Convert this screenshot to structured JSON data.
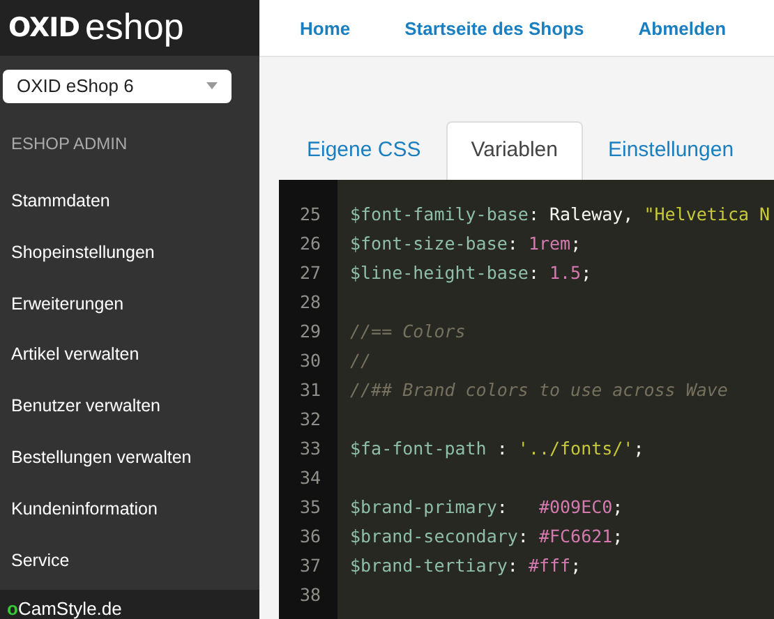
{
  "logo": {
    "bold": "OXID",
    "light": "eshop"
  },
  "top_nav": [
    "Home",
    "Startseite des Shops",
    "Abmelden"
  ],
  "shop_select": {
    "value": "OXID eShop 6"
  },
  "sidebar": {
    "heading": "ESHOP ADMIN",
    "items": [
      "Stammdaten",
      "Shopeinstellungen",
      "Erweiterungen",
      "Artikel verwalten",
      "Benutzer verwalten",
      "Bestellungen verwalten",
      "Kundeninformation",
      "Service"
    ],
    "footer": {
      "mark": "o",
      "label": "CamStyle.de"
    }
  },
  "tabs": [
    {
      "label": "Eigene CSS",
      "selected": false
    },
    {
      "label": "Variablen",
      "selected": true
    },
    {
      "label": "Einstellungen",
      "selected": false
    }
  ],
  "code": [
    {
      "n": "25",
      "tokens": [
        {
          "t": "$font-family-base",
          "kind": "var"
        },
        {
          "t": ": ",
          "kind": "plain"
        },
        {
          "t": "Raleway, ",
          "kind": "ident"
        },
        {
          "t": "\"Helvetica N",
          "kind": "string"
        }
      ]
    },
    {
      "n": "26",
      "tokens": [
        {
          "t": "$font-size-base",
          "kind": "var"
        },
        {
          "t": ": ",
          "kind": "plain"
        },
        {
          "t": "1rem",
          "kind": "number"
        },
        {
          "t": ";",
          "kind": "plain"
        }
      ]
    },
    {
      "n": "27",
      "tokens": [
        {
          "t": "$line-height-base",
          "kind": "var"
        },
        {
          "t": ": ",
          "kind": "plain"
        },
        {
          "t": "1.5",
          "kind": "number"
        },
        {
          "t": ";",
          "kind": "plain"
        }
      ]
    },
    {
      "n": "28"
    },
    {
      "n": "29",
      "tokens": [
        {
          "t": "//== Colors",
          "kind": "comment"
        }
      ]
    },
    {
      "n": "30",
      "tokens": [
        {
          "t": "//",
          "kind": "comment"
        }
      ]
    },
    {
      "n": "31",
      "tokens": [
        {
          "t": "//## Brand colors to use across Wave",
          "kind": "comment"
        }
      ]
    },
    {
      "n": "32"
    },
    {
      "n": "33",
      "tokens": [
        {
          "t": "$fa-font-path",
          "kind": "var"
        },
        {
          "t": " : ",
          "kind": "plain"
        },
        {
          "t": "'../fonts/'",
          "kind": "string"
        },
        {
          "t": ";",
          "kind": "plain"
        }
      ]
    },
    {
      "n": "34"
    },
    {
      "n": "35",
      "tokens": [
        {
          "t": "$brand-primary",
          "kind": "var"
        },
        {
          "t": ":   ",
          "kind": "plain"
        },
        {
          "t": "#009EC0",
          "kind": "number"
        },
        {
          "t": ";",
          "kind": "plain"
        }
      ]
    },
    {
      "n": "36",
      "tokens": [
        {
          "t": "$brand-secondary",
          "kind": "var"
        },
        {
          "t": ": ",
          "kind": "plain"
        },
        {
          "t": "#FC6621",
          "kind": "number"
        },
        {
          "t": ";",
          "kind": "plain"
        }
      ]
    },
    {
      "n": "37",
      "tokens": [
        {
          "t": "$brand-tertiary",
          "kind": "var"
        },
        {
          "t": ": ",
          "kind": "plain"
        },
        {
          "t": "#fff",
          "kind": "number"
        },
        {
          "t": ";",
          "kind": "plain"
        }
      ]
    },
    {
      "n": "38"
    }
  ]
}
